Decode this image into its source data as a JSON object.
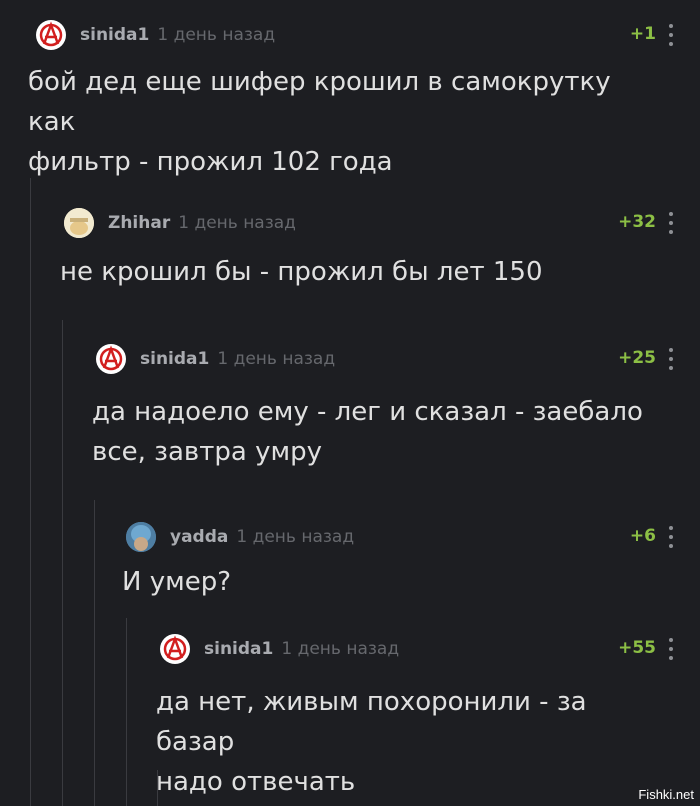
{
  "comments": [
    {
      "username": "sinida1",
      "time": "1 день назад",
      "rating": "+1",
      "text_lines": [
        "бой дед еще шифер крошил в самокрутку как",
        "фильтр - прожил 102 года"
      ],
      "avatar": "anarchy-icon"
    },
    {
      "username": "Zhihar",
      "time": "1 день назад",
      "rating": "+32",
      "text_lines": [
        "не крошил бы - прожил бы лет 150"
      ],
      "avatar": "user-avatar"
    },
    {
      "username": "sinida1",
      "time": "1 день назад",
      "rating": "+25",
      "text_lines": [
        "да надоело ему - лег и сказал - заебало",
        "все, завтра умру"
      ],
      "avatar": "anarchy-icon"
    },
    {
      "username": "yadda",
      "time": "1 день назад",
      "rating": "+6",
      "text_lines": [
        "И умер?"
      ],
      "avatar": "user-avatar"
    },
    {
      "username": "sinida1",
      "time": "1 день назад",
      "rating": "+55",
      "text_lines": [
        "да нет, живым похоронили - за базар",
        "надо отвечать"
      ],
      "avatar": "anarchy-icon"
    }
  ],
  "watermark": "Fishki.net",
  "colors": {
    "background": "#1d1e22",
    "rating": "#8cbf45",
    "username": "#a9abb0"
  }
}
